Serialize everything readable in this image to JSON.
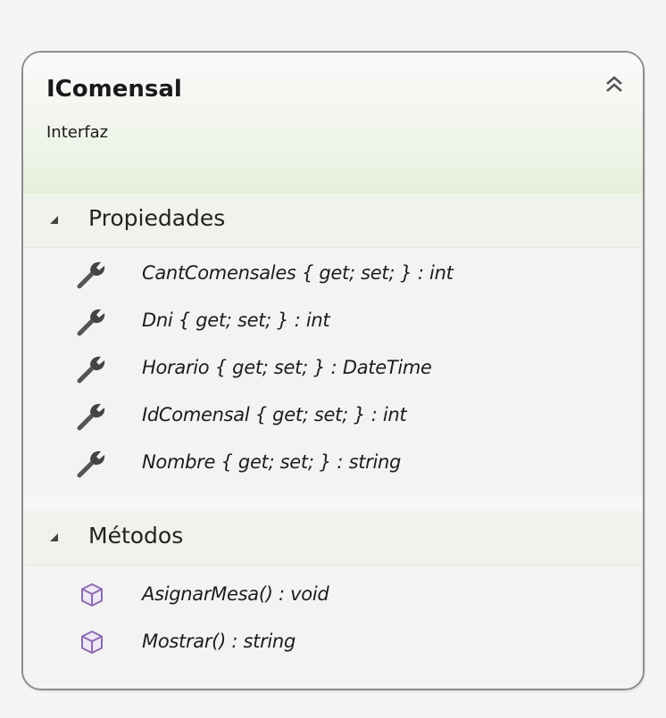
{
  "class": {
    "name": "IComensal",
    "stereotype": "Interfaz"
  },
  "sections": {
    "properties": {
      "label": "Propiedades",
      "items": [
        {
          "text": "CantComensales { get; set; } : int",
          "icon": "wrench-icon"
        },
        {
          "text": "Dni { get; set; } : int",
          "icon": "wrench-icon"
        },
        {
          "text": "Horario { get; set; } : DateTime",
          "icon": "wrench-icon"
        },
        {
          "text": "IdComensal { get; set; } : int",
          "icon": "wrench-icon"
        },
        {
          "text": "Nombre { get; set; } : string",
          "icon": "wrench-icon"
        }
      ]
    },
    "methods": {
      "label": "Métodos",
      "items": [
        {
          "text": "AsignarMesa() : void",
          "icon": "method-cube-icon"
        },
        {
          "text": "Mostrar() : string",
          "icon": "method-cube-icon"
        }
      ]
    }
  },
  "colors": {
    "method_icon": "#8a6bb0",
    "wrench_icon": "#505050"
  }
}
